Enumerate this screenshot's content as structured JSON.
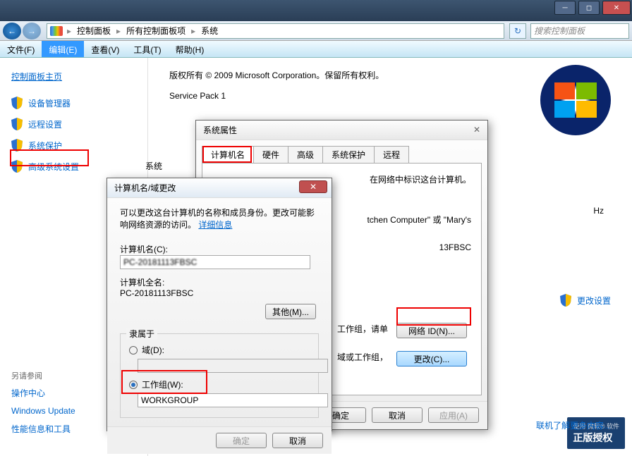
{
  "chrome": {
    "title": ""
  },
  "nav": {
    "crumbs": [
      "控制面板",
      "所有控制面板项",
      "系统"
    ],
    "search_placeholder": "搜索控制面板"
  },
  "menu": {
    "file": "文件(F)",
    "edit": "编辑(E)",
    "view": "查看(V)",
    "tools": "工具(T)",
    "help": "帮助(H)"
  },
  "sidebar": {
    "home": "控制面板主页",
    "tasks": [
      "设备管理器",
      "远程设置",
      "系统保护",
      "高级系统设置"
    ],
    "seealso": "另请参阅",
    "links": [
      "操作中心",
      "Windows Update",
      "性能信息和工具"
    ]
  },
  "main": {
    "copyright": "版权所有 © 2009 Microsoft Corporation。保留所有权利。",
    "sp": "Service Pack 1",
    "system_label": "系统",
    "hz": "Hz",
    "change_settings": "更改设置",
    "activation": {
      "top": "使用 微软® 软件",
      "main": "正版授权"
    },
    "online_help": "联机了解更多内容..."
  },
  "sysprops": {
    "title": "系统属性",
    "tabs": [
      "计算机名",
      "硬件",
      "高级",
      "系统保护",
      "远程"
    ],
    "desc_tail": "在网络中标识这台计算机。",
    "example_tail": "tchen Computer\" 或 \"Mary's",
    "fullname_tail": "13FBSC",
    "workgroup_prompt": "工作组，请单",
    "domain_prompt": "域或工作组，",
    "btn_netid": "网络 ID(N)...",
    "btn_change": "更改(C)...",
    "btn_ok": "确定",
    "btn_cancel": "取消",
    "btn_apply": "应用(A)"
  },
  "rename": {
    "title": "计算机名/域更改",
    "desc": "可以更改这台计算机的名称和成员身份。更改可能影响网络资源的访问。",
    "details": "详细信息",
    "name_label": "计算机名(C):",
    "name_value": "PC-20181113FBSC",
    "fullname_label": "计算机全名:",
    "fullname_value": "PC-20181113FBSC",
    "btn_more": "其他(M)...",
    "memberof": "隶属于",
    "domain": "域(D):",
    "workgroup": "工作组(W):",
    "workgroup_value": "WORKGROUP",
    "btn_ok": "确定",
    "btn_cancel": "取消"
  }
}
